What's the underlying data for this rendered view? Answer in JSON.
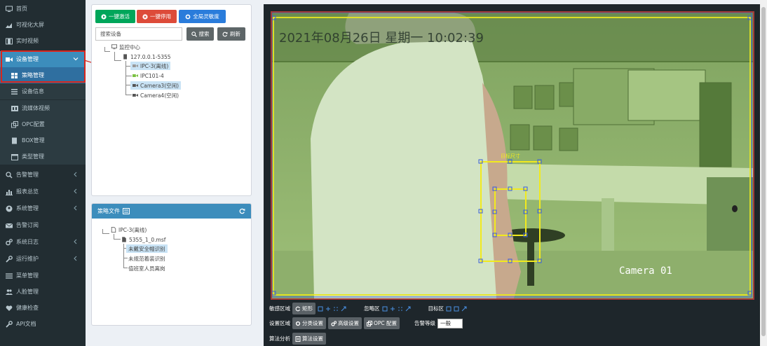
{
  "sidebar": {
    "items": [
      {
        "label": "首页",
        "icon": "monitor-icon"
      },
      {
        "label": "可视化大屏",
        "icon": "chart-area-icon"
      },
      {
        "label": "实时视频",
        "icon": "film-icon"
      },
      {
        "label": "设备管理",
        "icon": "video-camera-icon"
      },
      {
        "label": "策略管理",
        "icon": "th-large-icon"
      },
      {
        "label": "设备信息",
        "icon": "list-icon"
      },
      {
        "label": "流媒体视频",
        "icon": "media-icon"
      },
      {
        "label": "OPC配置",
        "icon": "clone-icon"
      },
      {
        "label": "BOX管理",
        "icon": "server-icon"
      },
      {
        "label": "类型管理",
        "icon": "calendar-icon"
      },
      {
        "label": "告警管理",
        "icon": "search-icon"
      },
      {
        "label": "报表总览",
        "icon": "bar-chart-icon"
      },
      {
        "label": "系统管理",
        "icon": "user-circle-icon"
      },
      {
        "label": "告警订阅",
        "icon": "envelope-icon"
      },
      {
        "label": "系统日志",
        "icon": "cogs-icon"
      },
      {
        "label": "运行维护",
        "icon": "wrench-icon"
      },
      {
        "label": "菜单管理",
        "icon": "bars-icon"
      },
      {
        "label": "人脸管理",
        "icon": "users-icon"
      },
      {
        "label": "健康检查",
        "icon": "heart-icon"
      },
      {
        "label": "API文档",
        "icon": "wrench-icon"
      }
    ]
  },
  "toolbar": {
    "activate_label": "一键激活",
    "disable_label": "一键停用",
    "sensitivity_label": "全局灵敏度",
    "search_placeholder": "搜索设备",
    "search_label": "搜索",
    "refresh_label": "刷新"
  },
  "device_tree": {
    "root": "监控中心",
    "server": "127.0.0.1-5355",
    "cameras": [
      {
        "label": "IPC-3(离线)",
        "status_color": "#999999"
      },
      {
        "label": "IPC101-4",
        "status_color": "#7bc142"
      },
      {
        "label": "Camera3(空闲)",
        "status_color": "#555555"
      },
      {
        "label": "Camera4(空闲)",
        "status_color": "#555555"
      }
    ]
  },
  "policy_panel": {
    "title": "策略文件",
    "root": "IPC-3(离线)",
    "file": "5355_1_0.msf",
    "rules": [
      "未戴安全帽识别",
      "未规范着装识别",
      "值班室人员离岗"
    ]
  },
  "video": {
    "timestamp": "2021年08月26日  星期一  10:02:39",
    "camera_label": "Camera 01",
    "target_label": "目标尺寸"
  },
  "controls": {
    "sensitive_region_label": "敏感区域",
    "rect_label": "矩形",
    "ignore_region_label": "忽略区",
    "target_region_label": "目标区",
    "setting_region_label": "设置区域",
    "classify_label": "分类设置",
    "advanced_label": "高级设置",
    "opc_label": "OPC 配置",
    "alarm_level_label": "告警等级",
    "alarm_level_value": "一般",
    "algo_label": "算法分析",
    "algo_setting_label": "算法设置"
  },
  "colors": {
    "sidebar_bg": "#222d32",
    "accent": "#3c8dbc",
    "highlight_border": "#d9251c",
    "target_box": "#f2ea1d"
  }
}
